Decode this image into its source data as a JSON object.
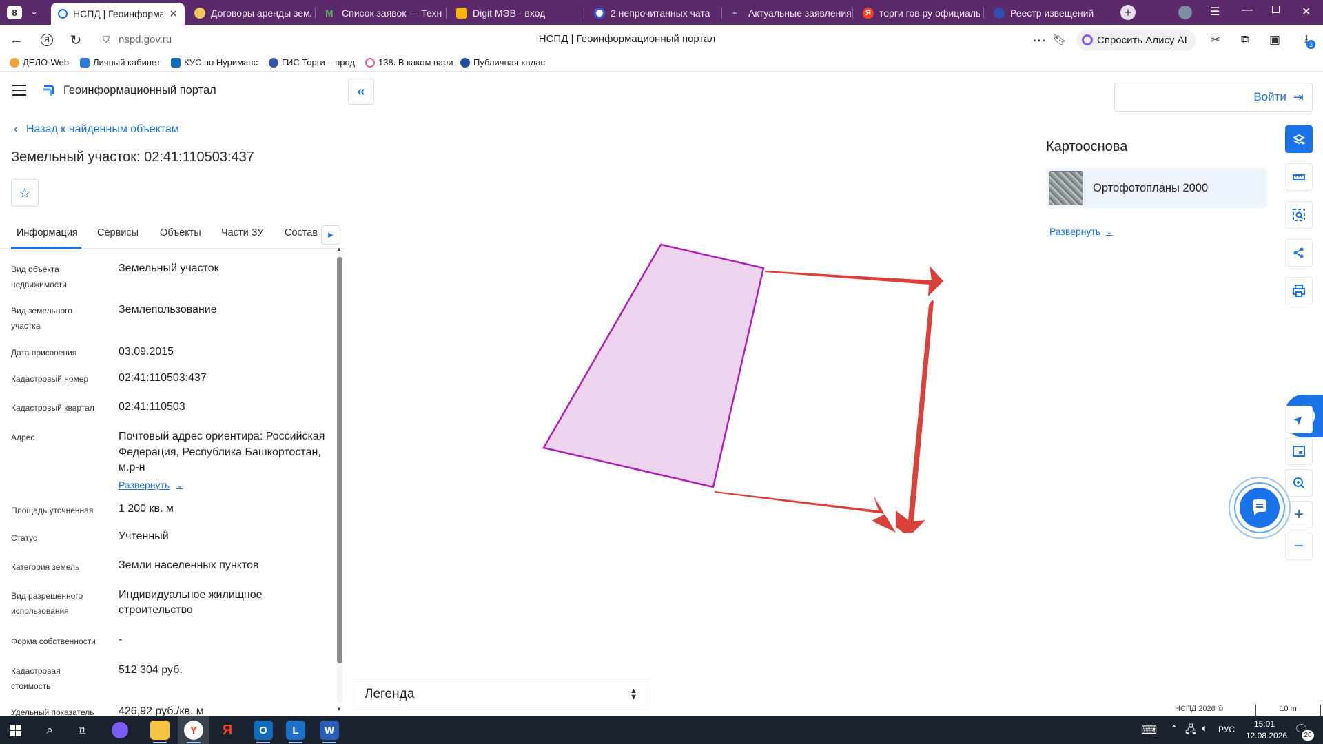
{
  "browser": {
    "tab_count": "8",
    "tabs": [
      {
        "title": "НСПД | Геоинформац",
        "active": true
      },
      {
        "title": "Договоры аренды земли"
      },
      {
        "title": "Список заявок — Техно"
      },
      {
        "title": "Digit МЭВ - вход"
      },
      {
        "title": "2 непрочитанных чата"
      },
      {
        "title": "Актуальные заявления"
      },
      {
        "title": "торги гов ру официальн"
      },
      {
        "title": "Реестр извещений"
      }
    ],
    "url": "nspd.gov.ru",
    "page_title": "НСПД | Геоинформационный портал",
    "alice_button": "Спросить Алису AI",
    "downloads_badge": "3",
    "bookmarks": [
      {
        "label": "ДЕЛО-Web"
      },
      {
        "label": "Личный кабинет"
      },
      {
        "label": "КУС по Нуриманс"
      },
      {
        "label": "ГИС Торги – прод"
      },
      {
        "label": "138. В каком вари"
      },
      {
        "label": "Публичная кадас"
      }
    ]
  },
  "portal": {
    "title": "Геоинформационный портал",
    "login_button": "Войти",
    "back_link": "Назад к найденным объектам",
    "object_title": "Земельный участок: 02:41:110503:437",
    "tabs": [
      "Информация",
      "Сервисы",
      "Объекты",
      "Части ЗУ",
      "Состав"
    ],
    "active_tab": "Информация",
    "expand_link": "Развернуть",
    "info": [
      {
        "label": "Вид объекта недвижимости",
        "value": "Земельный участок"
      },
      {
        "label": "Вид земельного участка",
        "value": "Землепользование"
      },
      {
        "label": "Дата присвоения",
        "value": "03.09.2015"
      },
      {
        "label": "Кадастровый номер",
        "value": "02:41:110503:437"
      },
      {
        "label": "Кадастровый квартал",
        "value": "02:41:110503"
      },
      {
        "label": "Адрес",
        "value": "Почтовый адрес ориентира: Российская Федерация, Республика Башкортостан, м.р-н"
      },
      {
        "label": "Площадь уточненная",
        "value": "1 200 кв. м"
      },
      {
        "label": "Статус",
        "value": "Учтенный"
      },
      {
        "label": "Категория земель",
        "value": "Земли населенных пунктов"
      },
      {
        "label": "Вид разрешенного использования",
        "value": "Индивидуальное жилищное строительство"
      },
      {
        "label": "Форма собственности",
        "value": "-"
      },
      {
        "label": "Кадастровая стоимость",
        "value": "512 304 руб."
      },
      {
        "label": "Удельный показатель",
        "value": "426,92 руб./кв. м"
      }
    ],
    "basemap": {
      "heading": "Картооснова",
      "layer": "Ортофотопланы 2000",
      "expand_link": "Развернуть"
    },
    "legend": "Легенда",
    "copyright": "НСПД 2026 ©",
    "scale_label": "10 m",
    "colors": {
      "parcel_stroke": "#b01fb5",
      "parcel_fill": "#ecd3ee",
      "arrow": "#d9413a",
      "accent": "#1a73e8"
    }
  },
  "taskbar": {
    "time": "15:01",
    "date": "12.08.2026",
    "language": "РУС",
    "notifications": "20"
  }
}
